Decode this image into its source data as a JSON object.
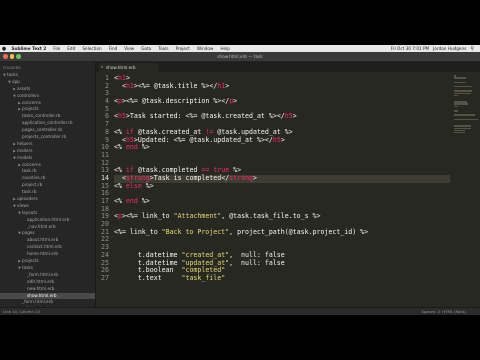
{
  "colors": {
    "tag": "#f92672",
    "string": "#e6db74",
    "text": "#f8f8f2",
    "background": "#272822"
  },
  "menubar": {
    "app": "Sublime Text 2",
    "items": [
      "File",
      "Edit",
      "Selection",
      "Find",
      "View",
      "Goto",
      "Tools",
      "Project",
      "Window",
      "Help"
    ],
    "clock": "Fri Oct 30 7:01 PM",
    "user": "Jordan Hudgens"
  },
  "window": {
    "title": "show.html.erb — task"
  },
  "tab": {
    "label": "show.html.erb",
    "close_glyph": "×"
  },
  "sidebar": {
    "header": "FOLDERS",
    "items": [
      {
        "label": "tasks",
        "depth": 0,
        "open": true
      },
      {
        "label": "app",
        "depth": 1,
        "open": true
      },
      {
        "label": "assets",
        "depth": 2,
        "open": false
      },
      {
        "label": "controllers",
        "depth": 2,
        "open": true
      },
      {
        "label": "concerns",
        "depth": 3,
        "open": false
      },
      {
        "label": "projects",
        "depth": 3,
        "open": false
      },
      {
        "label": "tasks_controller.rb",
        "depth": 3
      },
      {
        "label": "application_controller.rb",
        "depth": 3
      },
      {
        "label": "pages_controller.rb",
        "depth": 3
      },
      {
        "label": "projects_controller.rb",
        "depth": 3
      },
      {
        "label": "helpers",
        "depth": 2,
        "open": false
      },
      {
        "label": "mailers",
        "depth": 2,
        "open": false
      },
      {
        "label": "models",
        "depth": 2,
        "open": true
      },
      {
        "label": "concerns",
        "depth": 3,
        "open": false
      },
      {
        "label": "task.rb",
        "depth": 3
      },
      {
        "label": "counties.rb",
        "depth": 3
      },
      {
        "label": "project.rb",
        "depth": 3
      },
      {
        "label": "task.rb",
        "depth": 3
      },
      {
        "label": "uploaders",
        "depth": 2,
        "open": false
      },
      {
        "label": "views",
        "depth": 2,
        "open": true
      },
      {
        "label": "layouts",
        "depth": 3,
        "open": true
      },
      {
        "label": "application.html.erb",
        "depth": 4
      },
      {
        "label": "_nav.html.erb",
        "depth": 4
      },
      {
        "label": "pages",
        "depth": 3,
        "open": true
      },
      {
        "label": "about.html.erb",
        "depth": 4
      },
      {
        "label": "contact.html.erb",
        "depth": 4
      },
      {
        "label": "home.html.erb",
        "depth": 4
      },
      {
        "label": "projects",
        "depth": 3,
        "open": false
      },
      {
        "label": "tasks",
        "depth": 3,
        "open": true
      },
      {
        "label": "_form.html.erb",
        "depth": 4
      },
      {
        "label": "edit.html.erb",
        "depth": 4
      },
      {
        "label": "new.html.erb",
        "depth": 4
      },
      {
        "label": "show.html.erb",
        "depth": 4,
        "selected": true
      },
      {
        "label": "_form.html.erb",
        "depth": 3
      },
      {
        "label": "edit.html.erb",
        "depth": 3
      },
      {
        "label": "index.html.erb",
        "depth": 3
      },
      {
        "label": "index.json.jbuilder",
        "depth": 3
      },
      {
        "label": "new.html.erb",
        "depth": 3
      },
      {
        "label": "show.html.erb",
        "depth": 3
      },
      {
        "label": "show.json.jbuilder",
        "depth": 3
      },
      {
        "label": "bin",
        "depth": 1,
        "open": false
      }
    ]
  },
  "editor": {
    "current_line": 14,
    "lines": [
      [
        [
          "<",
          "t"
        ],
        [
          "h1",
          "g"
        ],
        [
          ">",
          "t"
        ]
      ],
      [
        [
          "  ",
          "t"
        ],
        [
          "<",
          "t"
        ],
        [
          "h1",
          "g"
        ],
        [
          ">",
          "t"
        ],
        [
          "<%= @task.title %>",
          "t"
        ],
        [
          "</",
          "t"
        ],
        [
          "h1",
          "g"
        ],
        [
          ">",
          "t"
        ]
      ],
      [],
      [
        [
          "<",
          "t"
        ],
        [
          "p",
          "g"
        ],
        [
          ">",
          "t"
        ],
        [
          "<%= @task.description %>",
          "t"
        ],
        [
          "</",
          "t"
        ],
        [
          "p",
          "g"
        ],
        [
          ">",
          "t"
        ]
      ],
      [],
      [
        [
          "<",
          "t"
        ],
        [
          "h5",
          "g"
        ],
        [
          ">",
          "t"
        ],
        [
          "Task started: <%= @task.created_at %>",
          "t"
        ],
        [
          "</",
          "t"
        ],
        [
          "h5",
          "g"
        ],
        [
          ">",
          "t"
        ]
      ],
      [],
      [
        [
          "<% ",
          "t"
        ],
        [
          "if",
          "g"
        ],
        [
          " @task.created_at ",
          "t"
        ],
        [
          "!=",
          "g"
        ],
        [
          " @task.updated_at %>",
          "t"
        ]
      ],
      [
        [
          "  ",
          "t"
        ],
        [
          "<",
          "t"
        ],
        [
          "h5",
          "g"
        ],
        [
          ">",
          "t"
        ],
        [
          "Updated: <%= @task.updated_at %>",
          "t"
        ],
        [
          "</",
          "t"
        ],
        [
          "h5",
          "g"
        ],
        [
          ">",
          "t"
        ]
      ],
      [
        [
          "<% ",
          "t"
        ],
        [
          "end",
          "g"
        ],
        [
          " %>",
          "t"
        ]
      ],
      [],
      [],
      [
        [
          "<% ",
          "t"
        ],
        [
          "if",
          "g"
        ],
        [
          " @task.completed ",
          "t"
        ],
        [
          "==",
          "g"
        ],
        [
          " ",
          "t"
        ],
        [
          "true",
          "g"
        ],
        [
          " %>",
          "t"
        ]
      ],
      [
        [
          "  ",
          "t"
        ],
        [
          "<",
          "t"
        ],
        [
          "strong",
          "g"
        ],
        [
          ">",
          "t"
        ],
        [
          "Task is completed",
          "t"
        ],
        [
          "</",
          "t"
        ],
        [
          "strong",
          "g"
        ],
        [
          ">",
          "t"
        ]
      ],
      [
        [
          "<% ",
          "t"
        ],
        [
          "else",
          "g"
        ],
        [
          " %>",
          "t"
        ]
      ],
      [],
      [
        [
          "<% ",
          "t"
        ],
        [
          "end",
          "g"
        ],
        [
          " %>",
          "t"
        ]
      ],
      [],
      [
        [
          "<",
          "t"
        ],
        [
          "p",
          "g"
        ],
        [
          ">",
          "t"
        ],
        [
          "<%= link_to ",
          "t"
        ],
        [
          "\"Attachment\"",
          "s"
        ],
        [
          ", @task.task_file.to_s %>",
          "t"
        ]
      ],
      [],
      [
        [
          "<%= link_to ",
          "t"
        ],
        [
          "\"Back to Project\"",
          "s"
        ],
        [
          ", project_path(@task.project_id) %>",
          "t"
        ]
      ],
      [],
      [],
      [
        [
          "      t.datetime ",
          "t"
        ],
        [
          "\"created_at\"",
          "s"
        ],
        [
          ",  null: false",
          "t"
        ]
      ],
      [
        [
          "      t.datetime ",
          "t"
        ],
        [
          "\"updated_at\"",
          "s"
        ],
        [
          ",  null: false",
          "t"
        ]
      ],
      [
        [
          "      t.boolean  ",
          "t"
        ],
        [
          "\"completed\"",
          "s"
        ]
      ],
      [
        [
          "      t.text     ",
          "t"
        ],
        [
          "\"task_file\"",
          "s"
        ]
      ]
    ]
  },
  "statusbar": {
    "left": "Line 14, Column 13",
    "spaces": "Spaces: 2",
    "syntax": "HTML (Rails)"
  }
}
